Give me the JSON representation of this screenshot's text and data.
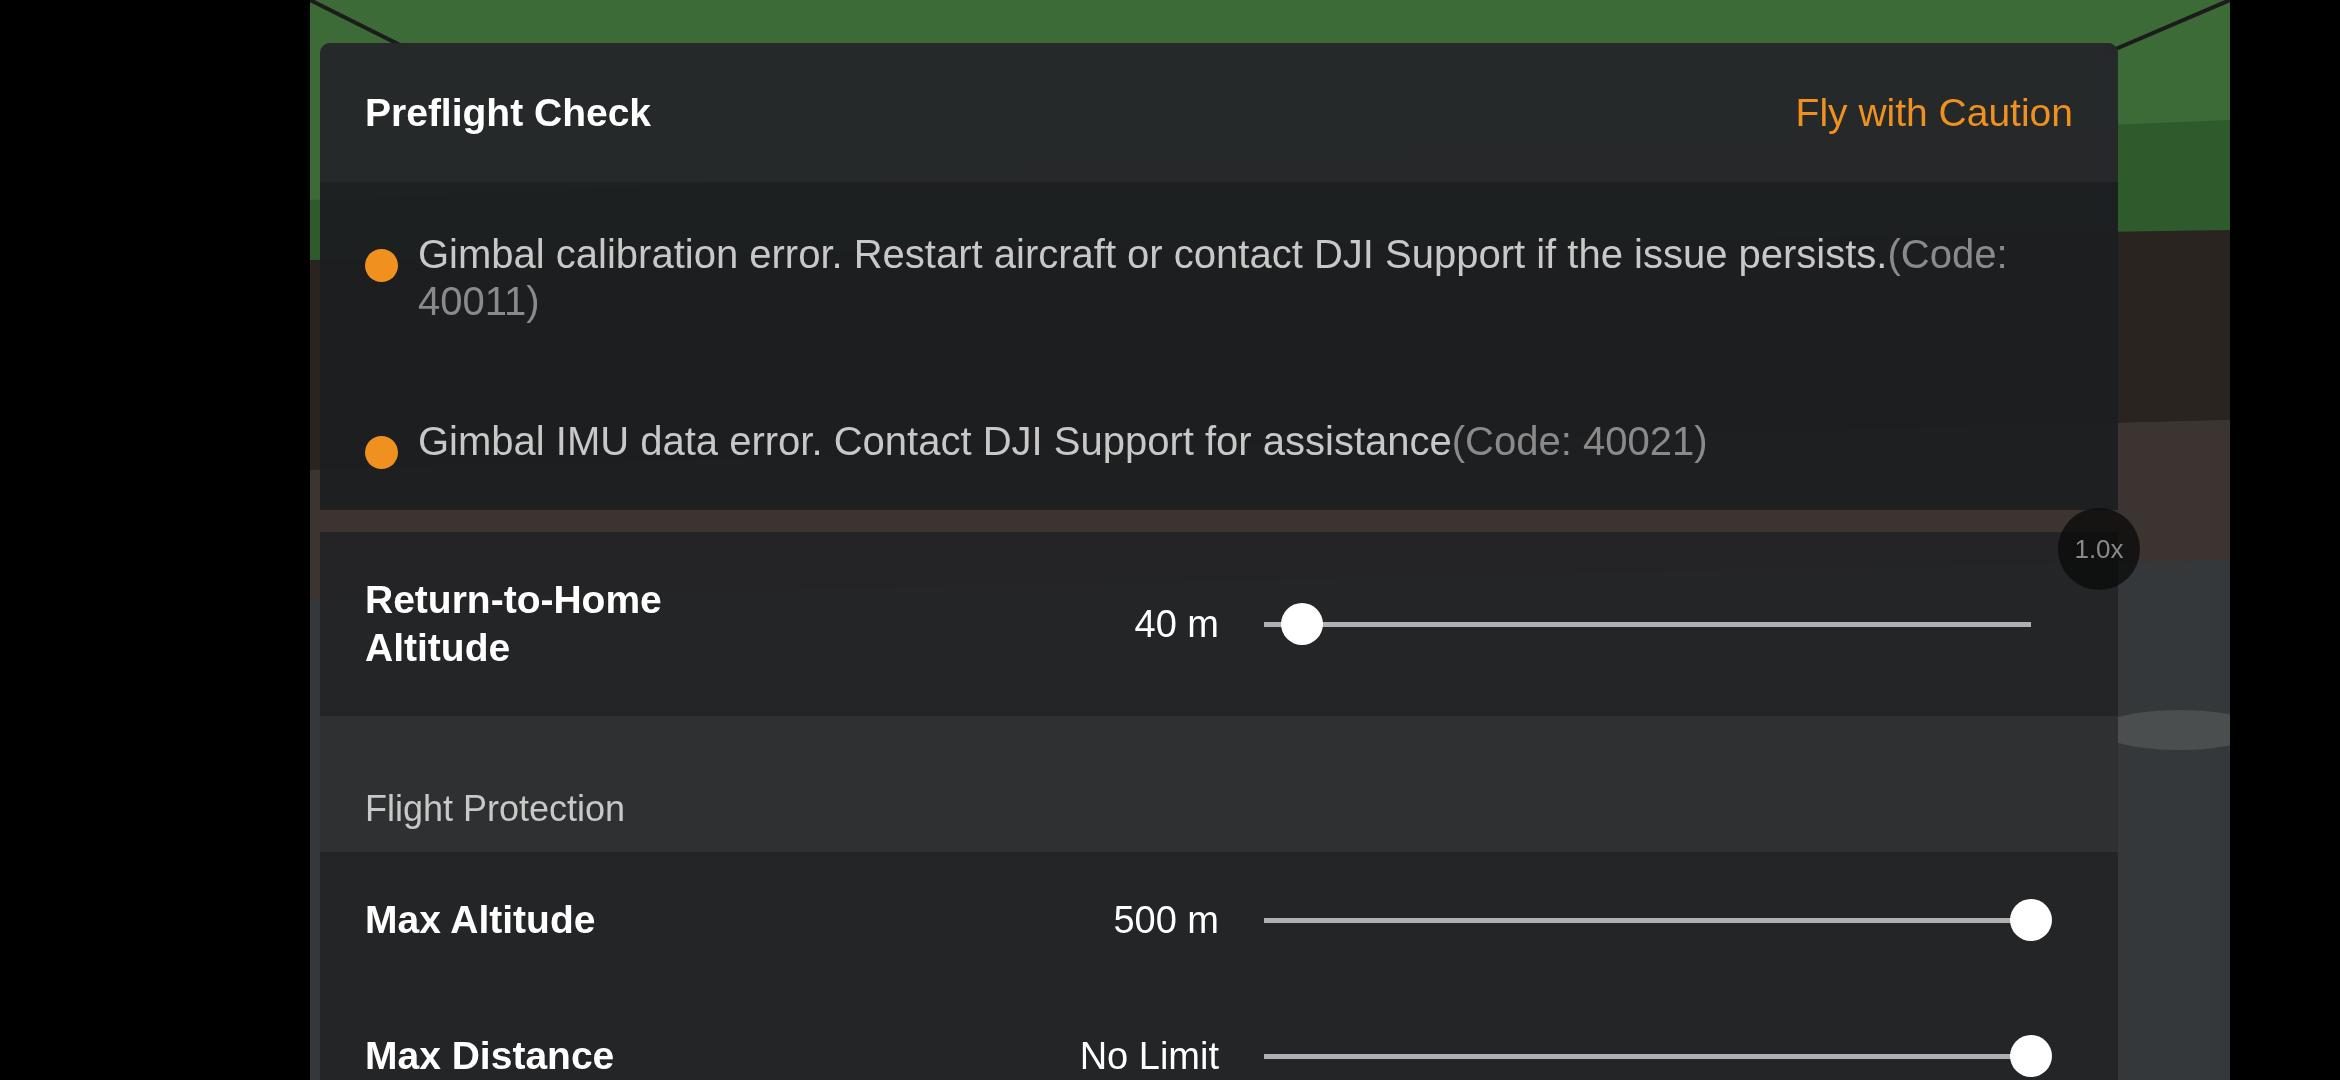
{
  "preflight": {
    "title": "Preflight Check",
    "status": "Fly with Caution",
    "alerts": [
      {
        "message": "Gimbal calibration error. Restart aircraft or contact DJI Support if the issue persists.",
        "code": "(Code: 40011)",
        "color": "#f0901e"
      },
      {
        "message": "Gimbal IMU data error. Contact DJI Support for assistance",
        "code": "(Code: 40021)",
        "color": "#f0901e"
      }
    ]
  },
  "zoom_badge": {
    "label": "1.0x"
  },
  "settings": [
    {
      "kind": "slider",
      "label": "Return-to-Home Altitude",
      "reading": "40 m",
      "level": 0.05
    },
    {
      "kind": "section",
      "label": "Flight Protection"
    },
    {
      "kind": "slider",
      "label": "Max Altitude",
      "reading": "500 m",
      "level": 1
    },
    {
      "kind": "slider",
      "label": "Max Distance",
      "reading": "No Limit",
      "level": 1
    }
  ]
}
